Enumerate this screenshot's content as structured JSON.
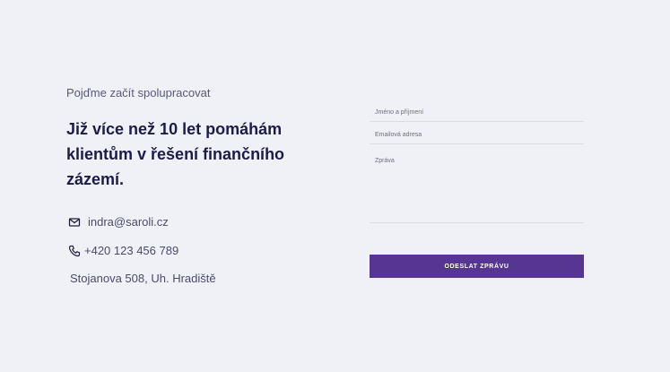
{
  "intro": {
    "eyebrow": "Pojďme začít spolupracovat",
    "headline": "Již více než 10 let pomáhám klientům v řešení finančního zázemí."
  },
  "contact": {
    "email": {
      "icon": "mail-icon",
      "text": "indra@saroli.cz"
    },
    "phone": {
      "icon": "phone-icon",
      "text": "+420 123 456 789"
    },
    "address": {
      "text": "Stojanova 508, Uh. Hradiště"
    }
  },
  "form": {
    "name_placeholder": "Jméno a příjmení",
    "email_placeholder": "Emailová adresa",
    "message_placeholder": "Zpráva",
    "submit_label": "ODESLAT ZPRÁVU"
  },
  "colors": {
    "background": "#eff1f6",
    "heading": "#1d1b47",
    "text": "#4a4b6a",
    "accent": "#563593",
    "field_border": "#d9dce6"
  }
}
